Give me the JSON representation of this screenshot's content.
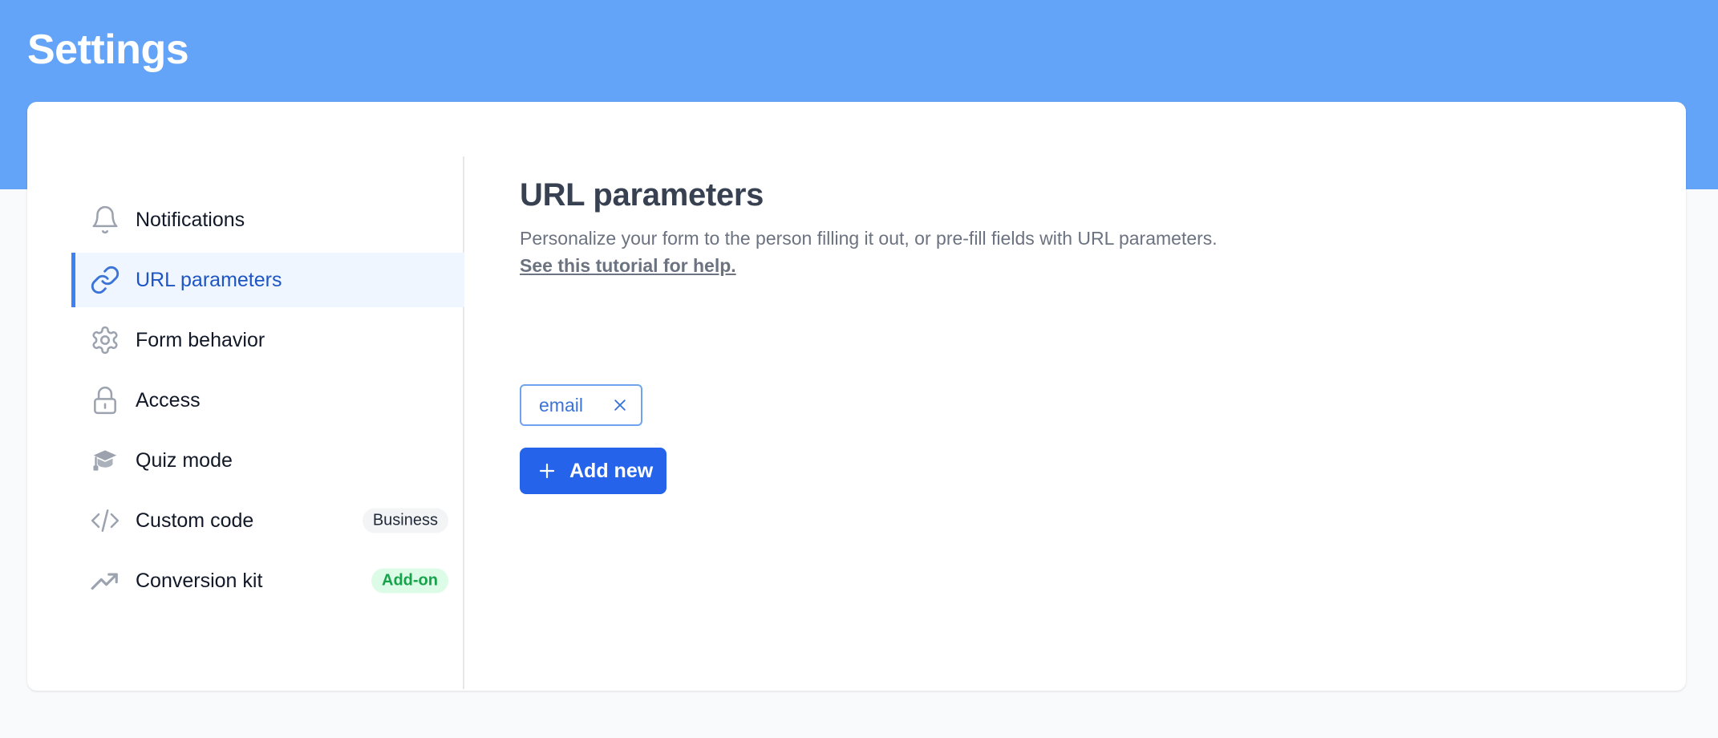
{
  "header": {
    "title": "Settings"
  },
  "sidebar": {
    "items": [
      {
        "label": "Notifications",
        "icon": "bell-icon",
        "active": false,
        "badge": null
      },
      {
        "label": "URL parameters",
        "icon": "link-icon",
        "active": true,
        "badge": null
      },
      {
        "label": "Form behavior",
        "icon": "gear-icon",
        "active": false,
        "badge": null
      },
      {
        "label": "Access",
        "icon": "lock-icon",
        "active": false,
        "badge": null
      },
      {
        "label": "Quiz mode",
        "icon": "graduation-cap-icon",
        "active": false,
        "badge": null
      },
      {
        "label": "Custom code",
        "icon": "code-icon",
        "active": false,
        "badge": "Business"
      },
      {
        "label": "Conversion kit",
        "icon": "trending-up-icon",
        "active": false,
        "badge": "Add-on"
      }
    ]
  },
  "main": {
    "title": "URL parameters",
    "description": "Personalize your form to the person filling it out, or pre-fill fields with URL parameters.",
    "tutorial_link": "See this tutorial for help.",
    "parameters": [
      "email"
    ],
    "add_button_label": "Add new"
  },
  "colors": {
    "header_bg": "#63a4f8",
    "accent": "#2563eb",
    "active_bg": "#eff6ff",
    "badge_green_bg": "#dcfce7",
    "badge_green_text": "#16a34a"
  }
}
